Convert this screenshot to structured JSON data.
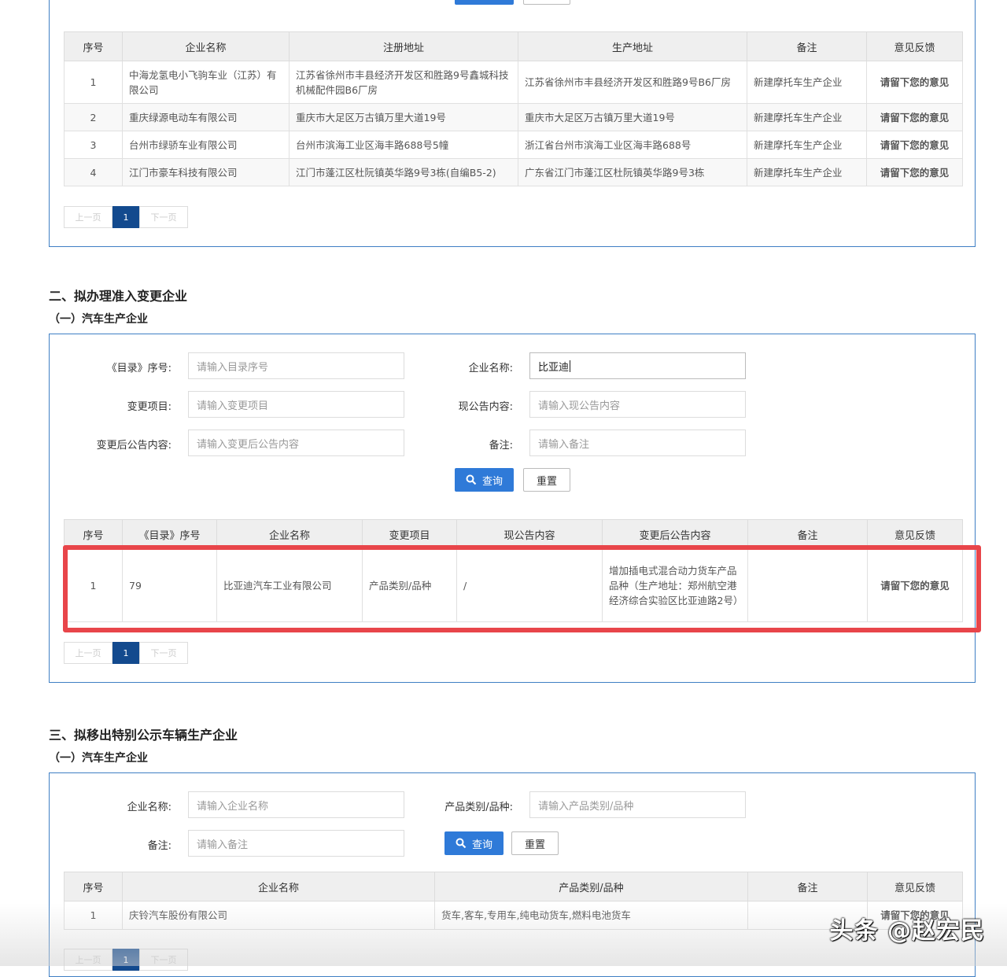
{
  "section1": {
    "headers": [
      "序号",
      "企业名称",
      "注册地址",
      "生产地址",
      "备注",
      "意见反馈"
    ],
    "rows": [
      {
        "no": "1",
        "name": "中海龙氢电小飞驹车业（江苏）有限公司",
        "reg": "江苏省徐州市丰县经济开发区和胜路9号鑫城科技机械配件园B6厂房",
        "prod": "江苏省徐州市丰县经济开发区和胜路9号B6厂房",
        "note": "新建摩托车生产企业",
        "fb": "请留下您的意见"
      },
      {
        "no": "2",
        "name": "重庆绿源电动车有限公司",
        "reg": "重庆市大足区万古镇万里大道19号",
        "prod": "重庆市大足区万古镇万里大道19号",
        "note": "新建摩托车生产企业",
        "fb": "请留下您的意见"
      },
      {
        "no": "3",
        "name": "台州市绿骄车业有限公司",
        "reg": "台州市滨海工业区海丰路688号5幢",
        "prod": "浙江省台州市滨海工业区海丰路688号",
        "note": "新建摩托车生产企业",
        "fb": "请留下您的意见"
      },
      {
        "no": "4",
        "name": "江门市豪车科技有限公司",
        "reg": "江门市蓬江区杜阮镇英华路9号3栋(自编B5-2)",
        "prod": "广东省江门市蓬江区杜阮镇英华路9号3栋",
        "note": "新建摩托车生产企业",
        "fb": "请留下您的意见"
      }
    ],
    "pager": {
      "prev": "上一页",
      "page": "1",
      "next": "下一页"
    }
  },
  "section2": {
    "title": "二、拟办理准入变更企业",
    "subtitle": "（一）汽车生产企业",
    "form": {
      "catalog_label": "《目录》序号:",
      "catalog_ph": "请输入目录序号",
      "company_label": "企业名称:",
      "company_value": "比亚迪",
      "change_label": "变更项目:",
      "change_ph": "请输入变更项目",
      "current_label": "现公告内容:",
      "current_ph": "请输入现公告内容",
      "after_label": "变更后公告内容:",
      "after_ph": "请输入变更后公告内容",
      "note_label": "备注:",
      "note_ph": "请输入备注",
      "query": "查询",
      "reset": "重置"
    },
    "headers": [
      "序号",
      "《目录》序号",
      "企业名称",
      "变更项目",
      "现公告内容",
      "变更后公告内容",
      "备注",
      "意见反馈"
    ],
    "rows": [
      {
        "no": "1",
        "catalog": "79",
        "name": "比亚迪汽车工业有限公司",
        "item": "产品类别/品种",
        "current": "/",
        "after": "增加插电式混合动力货车产品品种（生产地址：郑州航空港经济综合实验区比亚迪路2号）",
        "note": "",
        "fb": "请留下您的意见"
      }
    ],
    "pager": {
      "prev": "上一页",
      "page": "1",
      "next": "下一页"
    }
  },
  "section3": {
    "title": "三、拟移出特别公示车辆生产企业",
    "subtitle": "（一）汽车生产企业",
    "form": {
      "company_label": "企业名称:",
      "company_ph": "请输入企业名称",
      "category_label": "产品类别/品种:",
      "category_ph": "请输入产品类别/品种",
      "note_label": "备注:",
      "note_ph": "请输入备注",
      "query": "查询",
      "reset": "重置"
    },
    "headers": [
      "序号",
      "企业名称",
      "产品类别/品种",
      "备注",
      "意见反馈"
    ],
    "rows": [
      {
        "no": "1",
        "name": "庆铃汽车股份有限公司",
        "category": "货车,客车,专用车,纯电动货车,燃料电池货车",
        "note": "",
        "fb": "请留下您的意见"
      }
    ],
    "pager": {
      "prev": "上一页",
      "page": "1",
      "next": "下一页"
    }
  },
  "watermark": "头条 @赵宏民",
  "colors": {
    "accent": "#2f7ad8",
    "pager_active": "#134a8e",
    "border": "#3f7fc4",
    "highlight": "#e8454a"
  }
}
